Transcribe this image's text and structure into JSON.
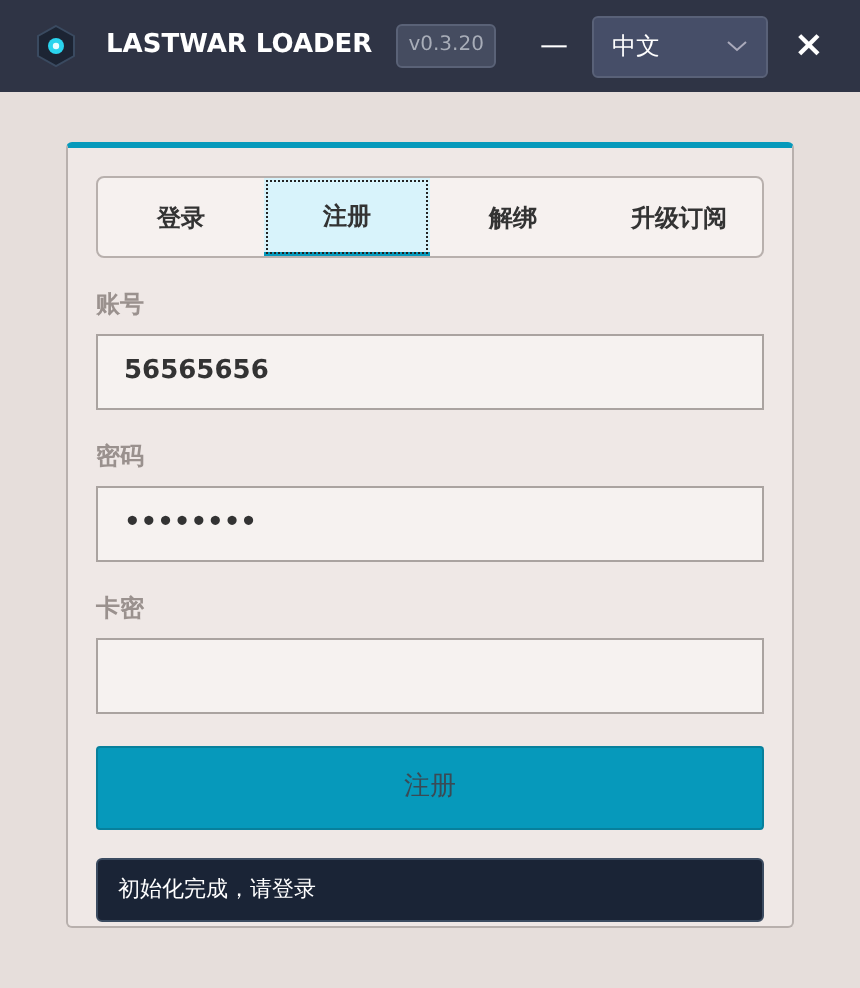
{
  "window": {
    "title": "LASTWAR LOADER",
    "version": "v0.3.20",
    "minimize": "—",
    "close": "×"
  },
  "language": {
    "value": "中文"
  },
  "tabs": [
    {
      "label": "登录",
      "selected": false
    },
    {
      "label": "注册",
      "selected": true
    },
    {
      "label": "解绑",
      "selected": false
    },
    {
      "label": "升级订阅",
      "selected": false
    }
  ],
  "fields": [
    {
      "label": "账号",
      "value": "56565656"
    },
    {
      "label": "密码",
      "value": "••••••••"
    },
    {
      "label": "卡密"
    }
  ],
  "submit": "注册",
  "status": "初始化完成，请登录"
}
